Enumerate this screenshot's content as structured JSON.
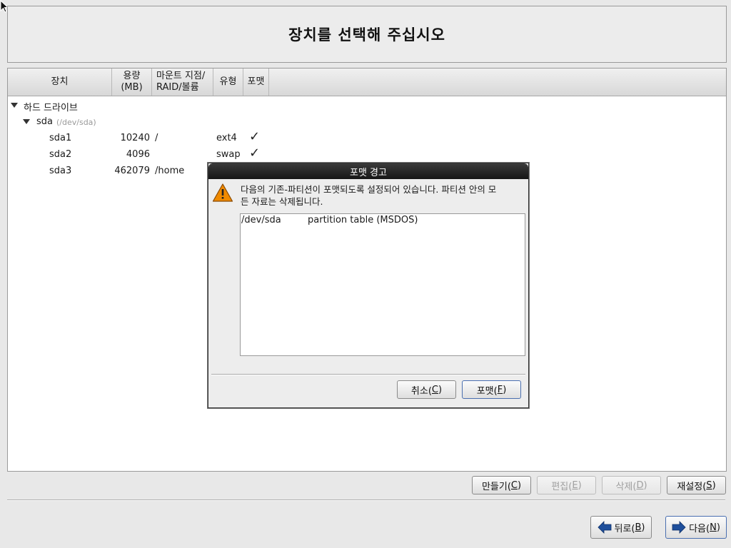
{
  "title": "장치를 선택해 주십시오",
  "columns": {
    "device": "장치",
    "size_line1": "용량",
    "size_line2": "(MB)",
    "mount_line1": "마운트 지점/",
    "mount_line2": "RAID/볼륨",
    "type": "유형",
    "format": "포맷"
  },
  "tree": {
    "group_label": "하드 드라이브",
    "disk": {
      "name": "sda",
      "path": "(/dev/sda)"
    },
    "partitions": [
      {
        "device": "sda1",
        "size": "10240",
        "mount": "/",
        "type": "ext4",
        "format": "✓"
      },
      {
        "device": "sda2",
        "size": "4096",
        "mount": "",
        "type": "swap",
        "format": "✓"
      },
      {
        "device": "sda3",
        "size": "462079",
        "mount": "/home",
        "type": "",
        "format": ""
      }
    ]
  },
  "actions": {
    "create": {
      "label": "만들기(",
      "key": "C",
      "end": ")"
    },
    "edit": {
      "label": "편집(",
      "key": "E",
      "end": ")"
    },
    "delete": {
      "label": "삭제(",
      "key": "D",
      "end": ")"
    },
    "reset": {
      "label": "재설정(",
      "key": "S",
      "end": ")"
    }
  },
  "nav": {
    "back": {
      "label": "뒤로(",
      "key": "B",
      "end": ")"
    },
    "next": {
      "label": "다음(",
      "key": "N",
      "end": ")"
    }
  },
  "dialog": {
    "title": "포맷 경고",
    "message_line1": "다음의 기존-파티션이 포맷되도록 설정되어 있습니다. 파티션 안의 모",
    "message_line2": "든 자료는 삭제됩니다.",
    "items": [
      {
        "device": "/dev/sda",
        "description": "partition table (MSDOS)"
      }
    ],
    "cancel": {
      "label": "취소(",
      "key": "C",
      "end": ")"
    },
    "format": {
      "label": "포맷(",
      "key": "F",
      "end": ")"
    }
  },
  "colors": {
    "dialog_titlebar": "#1e1e1e",
    "warning": "#f08a00",
    "nav_arrow": "#1f4f9c"
  },
  "icons": {
    "warning": "warning-icon",
    "back": "arrow-left-icon",
    "next": "arrow-right-icon"
  }
}
